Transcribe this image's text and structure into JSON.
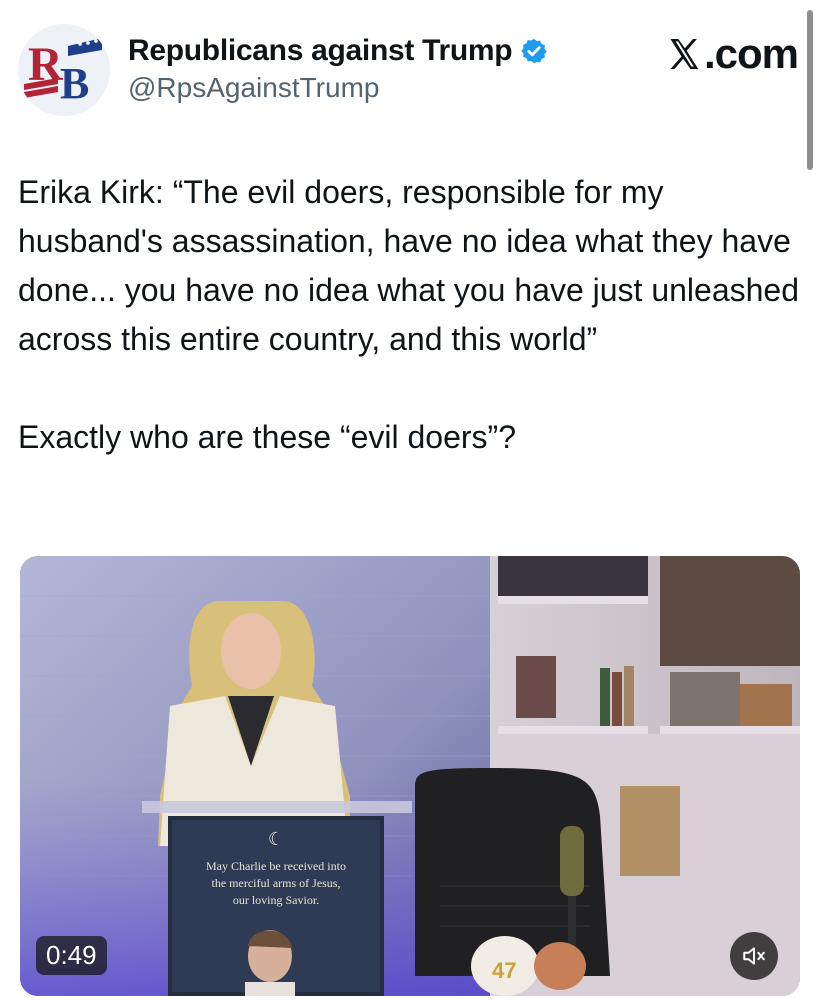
{
  "account": {
    "display_name": "Republicans against Trump",
    "handle": "@RpsAgainstTrump",
    "avatar_letters": "RB",
    "verified": true,
    "verified_color": "#1d9bf0"
  },
  "brand": {
    "text": ".com",
    "icon": "x-logo-icon"
  },
  "tweet": {
    "text": "Erika Kirk: “The evil doers, responsible for my husband's assassination, have no idea what they have done... you have no idea what you have just unleashed across this entire country, and this world”\n\nExactly who are these “evil doers”?"
  },
  "video": {
    "duration": "0:49",
    "sign_symbol": "☾",
    "sign_lines": [
      "May Charlie be received into",
      "the merciful arms of Jesus,",
      "our loving Savior."
    ],
    "mute_icon": "speaker-muted-icon"
  }
}
